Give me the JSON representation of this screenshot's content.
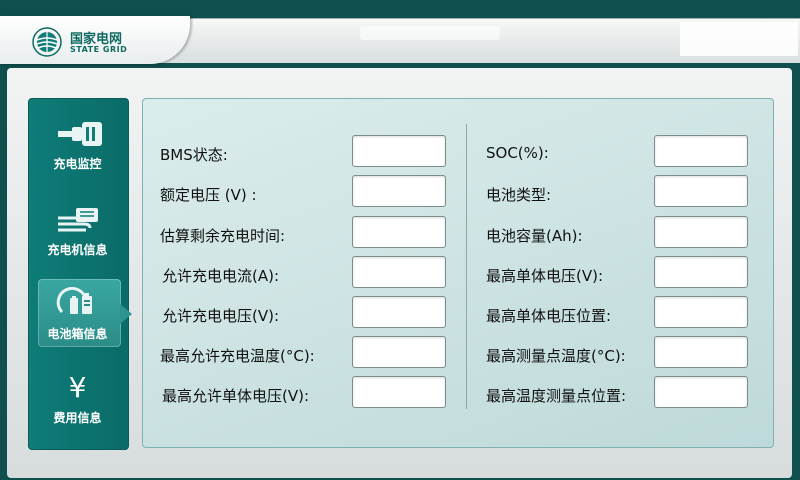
{
  "header": {
    "brand_cn": "国家电网",
    "brand_en": "STATE GRID"
  },
  "sidebar": {
    "items": [
      {
        "label": "充电监控",
        "icon": "plug-connector-icon",
        "active": false
      },
      {
        "label": "充电机信息",
        "icon": "charger-hand-icon",
        "active": false
      },
      {
        "label": "电池箱信息",
        "icon": "battery-box-icon",
        "active": true
      },
      {
        "label": "费用信息",
        "icon": "yen-icon",
        "icon_text": "¥",
        "active": false
      }
    ]
  },
  "form": {
    "left": [
      {
        "label": "BMS状态:",
        "value": ""
      },
      {
        "label": "额定电压 (V) :",
        "value": ""
      },
      {
        "label": "估算剩余充电时间:",
        "value": ""
      },
      {
        "label": "允许充电电流(A):",
        "value": ""
      },
      {
        "label": "允许充电电压(V):",
        "value": ""
      },
      {
        "label": "最高允许充电温度(°C):",
        "value": ""
      },
      {
        "label": "最高允许单体电压(V):",
        "value": ""
      }
    ],
    "right": [
      {
        "label": "SOC(%):",
        "value": ""
      },
      {
        "label": "电池类型:",
        "value": ""
      },
      {
        "label": "电池容量(Ah):",
        "value": ""
      },
      {
        "label": "最高单体电压(V):",
        "value": ""
      },
      {
        "label": "最高单体电压位置:",
        "value": ""
      },
      {
        "label": "最高测量点温度(°C):",
        "value": ""
      },
      {
        "label": "最高温度测量点位置:",
        "value": ""
      }
    ]
  },
  "colors": {
    "accent": "#0f7c78",
    "frame": "#0f4f4d",
    "active_nav": "#2f948f"
  }
}
